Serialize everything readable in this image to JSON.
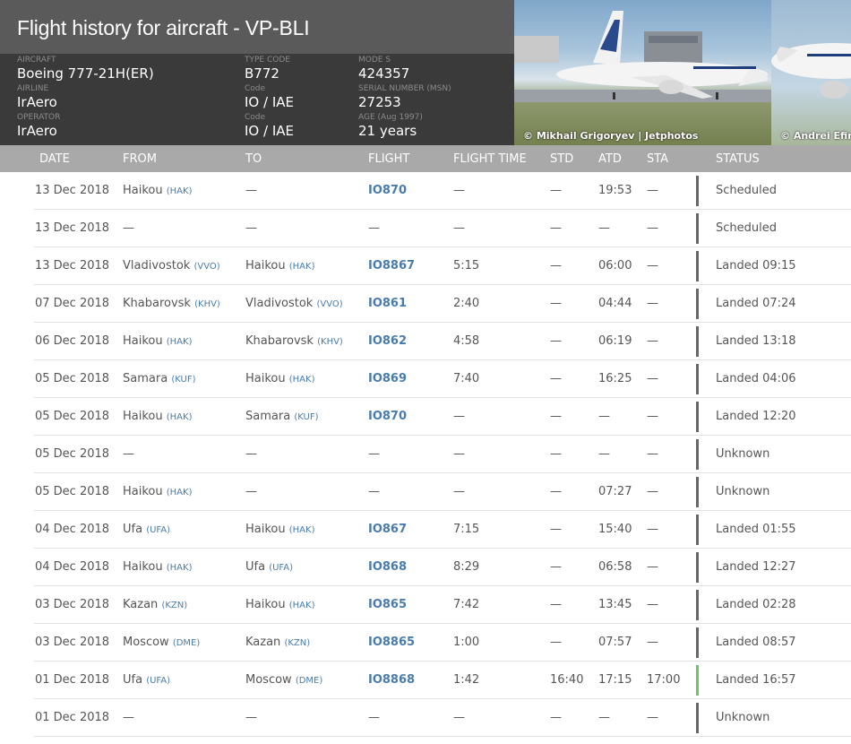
{
  "header": {
    "title": "Flight history for aircraft - VP-BLI",
    "aircraft_label": "AIRCRAFT",
    "aircraft": "Boeing 777-21H(ER)",
    "type_code_label": "TYPE CODE",
    "type_code": "B772",
    "mode_s_label": "MODE S",
    "mode_s": "424357",
    "airline_label": "AIRLINE",
    "airline": "IrAero",
    "airline_code_label": "Code",
    "airline_code": "IO / IAE",
    "serial_label": "SERIAL NUMBER (MSN)",
    "serial": "27253",
    "operator_label": "OPERATOR",
    "operator": "IrAero",
    "operator_code_label": "Code",
    "operator_code": "IO / IAE",
    "age_label": "AGE (Aug 1997)",
    "age": "21 years"
  },
  "photos": [
    {
      "credit": "© Mikhail Grigoryev | Jetphotos",
      "livery": "IRAERO"
    },
    {
      "credit": "© Andrei Efim",
      "livery": "IRAERO"
    }
  ],
  "columns": {
    "date": "DATE",
    "from": "FROM",
    "to": "TO",
    "flight": "FLIGHT",
    "flight_time": "FLIGHT TIME",
    "std": "STD",
    "atd": "ATD",
    "sta": "STA",
    "status": "STATUS"
  },
  "colors": {
    "status_bar_default": "#666666",
    "status_bar_green": "#6cc36c",
    "link": "#4a7cab"
  },
  "rows": [
    {
      "date": "13 Dec 2018",
      "from": "Haikou",
      "from_code": "(HAK)",
      "to": "—",
      "to_code": "",
      "flight": "IO870",
      "time": "—",
      "std": "—",
      "atd": "19:53",
      "sta": "—",
      "status": "Scheduled",
      "bar": "grey"
    },
    {
      "date": "13 Dec 2018",
      "from": "—",
      "from_code": "",
      "to": "—",
      "to_code": "",
      "flight": "—",
      "time": "—",
      "std": "—",
      "atd": "—",
      "sta": "—",
      "status": "Scheduled",
      "bar": "grey"
    },
    {
      "date": "13 Dec 2018",
      "from": "Vladivostok",
      "from_code": "(VVO)",
      "to": "Haikou",
      "to_code": "(HAK)",
      "flight": "IO8867",
      "time": "5:15",
      "std": "—",
      "atd": "06:00",
      "sta": "—",
      "status": "Landed 09:15",
      "bar": "grey"
    },
    {
      "date": "07 Dec 2018",
      "from": "Khabarovsk",
      "from_code": "(KHV)",
      "to": "Vladivostok",
      "to_code": "(VVO)",
      "flight": "IO861",
      "time": "2:40",
      "std": "—",
      "atd": "04:44",
      "sta": "—",
      "status": "Landed 07:24",
      "bar": "grey"
    },
    {
      "date": "06 Dec 2018",
      "from": "Haikou",
      "from_code": "(HAK)",
      "to": "Khabarovsk",
      "to_code": "(KHV)",
      "flight": "IO862",
      "time": "4:58",
      "std": "—",
      "atd": "06:19",
      "sta": "—",
      "status": "Landed 13:18",
      "bar": "grey"
    },
    {
      "date": "05 Dec 2018",
      "from": "Samara",
      "from_code": "(KUF)",
      "to": "Haikou",
      "to_code": "(HAK)",
      "flight": "IO869",
      "time": "7:40",
      "std": "—",
      "atd": "16:25",
      "sta": "—",
      "status": "Landed 04:06",
      "bar": "grey"
    },
    {
      "date": "05 Dec 2018",
      "from": "Haikou",
      "from_code": "(HAK)",
      "to": "Samara",
      "to_code": "(KUF)",
      "flight": "IO870",
      "time": "—",
      "std": "—",
      "atd": "—",
      "sta": "—",
      "status": "Landed 12:20",
      "bar": "grey"
    },
    {
      "date": "05 Dec 2018",
      "from": "—",
      "from_code": "",
      "to": "—",
      "to_code": "",
      "flight": "—",
      "time": "—",
      "std": "—",
      "atd": "—",
      "sta": "—",
      "status": "Unknown",
      "bar": "grey"
    },
    {
      "date": "05 Dec 2018",
      "from": "Haikou",
      "from_code": "(HAK)",
      "to": "—",
      "to_code": "",
      "flight": "—",
      "time": "—",
      "std": "—",
      "atd": "07:27",
      "sta": "—",
      "status": "Unknown",
      "bar": "grey"
    },
    {
      "date": "04 Dec 2018",
      "from": "Ufa",
      "from_code": "(UFA)",
      "to": "Haikou",
      "to_code": "(HAK)",
      "flight": "IO867",
      "time": "7:15",
      "std": "—",
      "atd": "15:40",
      "sta": "—",
      "status": "Landed 01:55",
      "bar": "grey"
    },
    {
      "date": "04 Dec 2018",
      "from": "Haikou",
      "from_code": "(HAK)",
      "to": "Ufa",
      "to_code": "(UFA)",
      "flight": "IO868",
      "time": "8:29",
      "std": "—",
      "atd": "06:58",
      "sta": "—",
      "status": "Landed 12:27",
      "bar": "grey"
    },
    {
      "date": "03 Dec 2018",
      "from": "Kazan",
      "from_code": "(KZN)",
      "to": "Haikou",
      "to_code": "(HAK)",
      "flight": "IO865",
      "time": "7:42",
      "std": "—",
      "atd": "13:45",
      "sta": "—",
      "status": "Landed 02:28",
      "bar": "grey"
    },
    {
      "date": "03 Dec 2018",
      "from": "Moscow",
      "from_code": "(DME)",
      "to": "Kazan",
      "to_code": "(KZN)",
      "flight": "IO8865",
      "time": "1:00",
      "std": "—",
      "atd": "07:57",
      "sta": "—",
      "status": "Landed 08:57",
      "bar": "grey"
    },
    {
      "date": "01 Dec 2018",
      "from": "Ufa",
      "from_code": "(UFA)",
      "to": "Moscow",
      "to_code": "(DME)",
      "flight": "IO8868",
      "time": "1:42",
      "std": "16:40",
      "atd": "17:15",
      "sta": "17:00",
      "status": "Landed 16:57",
      "bar": "green"
    },
    {
      "date": "01 Dec 2018",
      "from": "—",
      "from_code": "",
      "to": "—",
      "to_code": "",
      "flight": "—",
      "time": "—",
      "std": "—",
      "atd": "—",
      "sta": "—",
      "status": "Unknown",
      "bar": "grey"
    }
  ]
}
